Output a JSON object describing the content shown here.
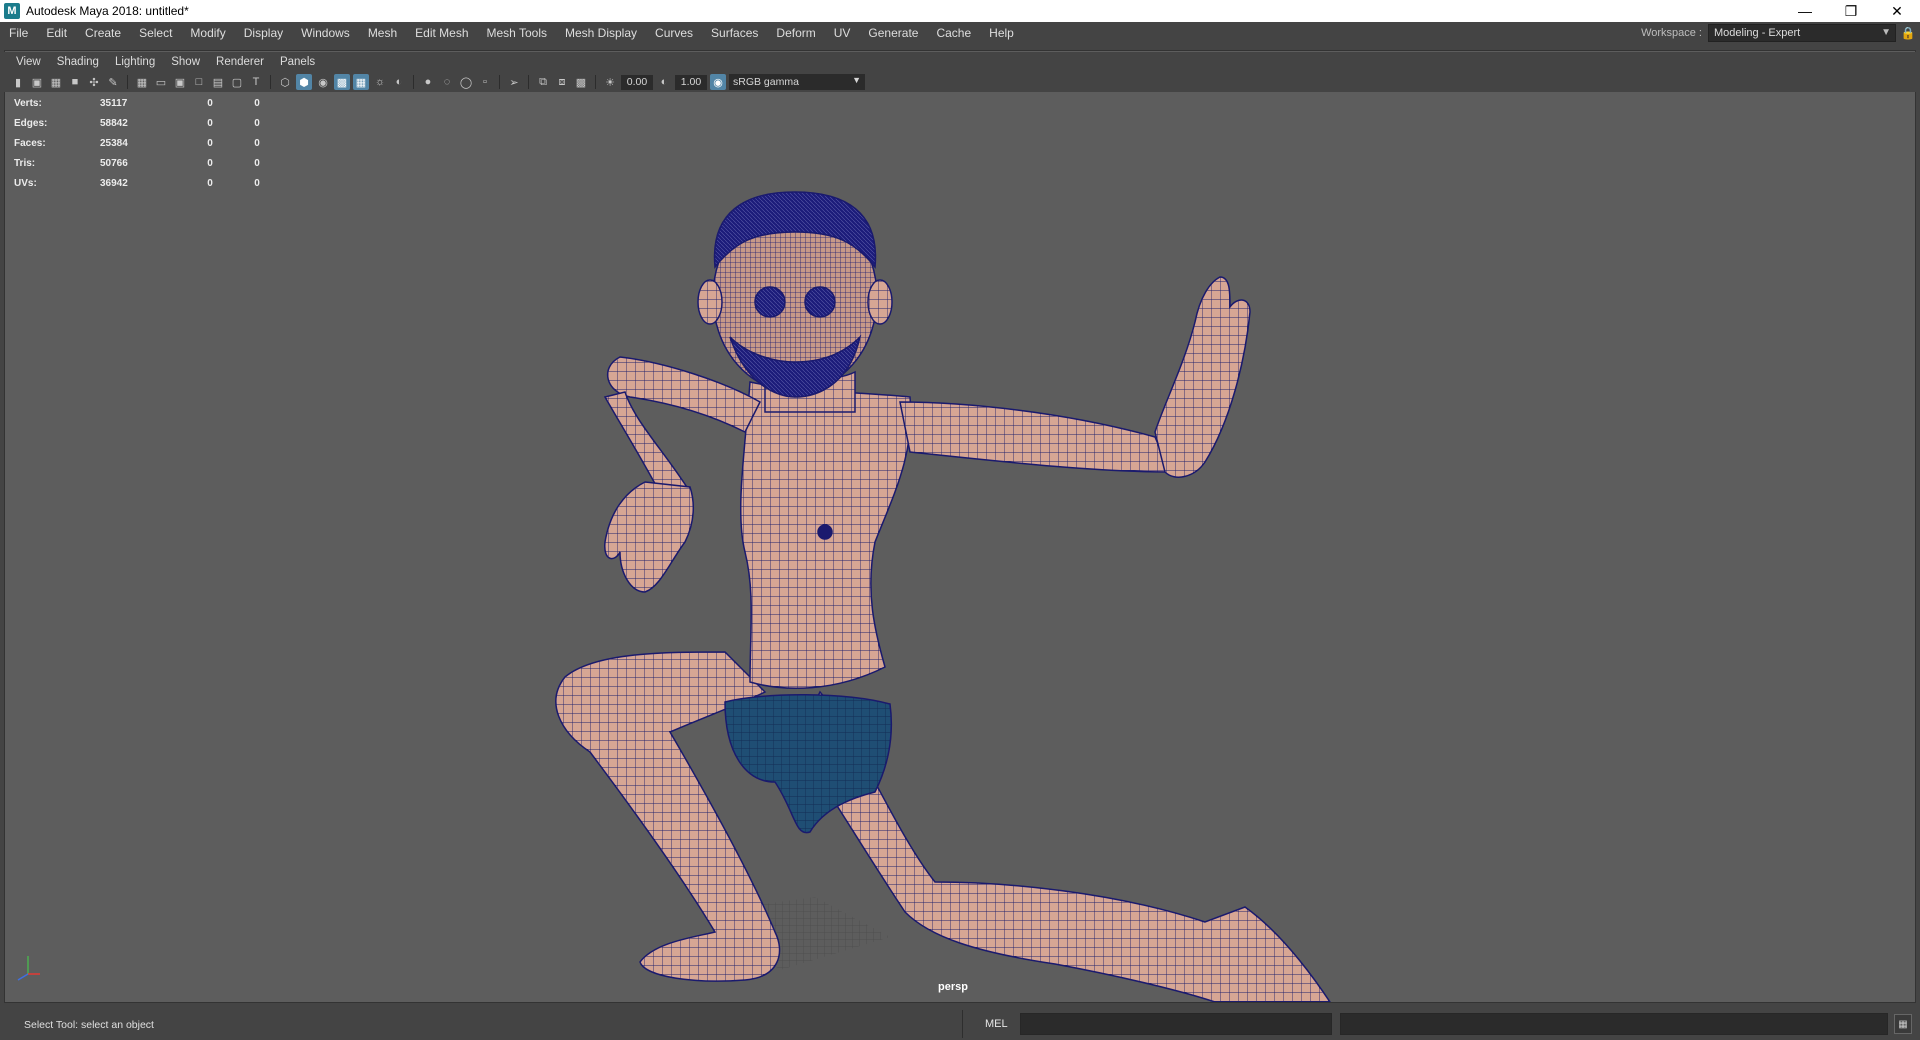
{
  "window": {
    "app_icon": "M",
    "title": "Autodesk Maya 2018: untitled*",
    "controls": [
      "minimize-icon",
      "restore-icon",
      "close-icon"
    ]
  },
  "menubar": {
    "items": [
      "File",
      "Edit",
      "Create",
      "Select",
      "Modify",
      "Display",
      "Windows",
      "Mesh",
      "Edit Mesh",
      "Mesh Tools",
      "Mesh Display",
      "Curves",
      "Surfaces",
      "Deform",
      "UV",
      "Generate",
      "Cache",
      "Help"
    ]
  },
  "workspace": {
    "label": "Workspace :",
    "value": "Modeling - Expert"
  },
  "panel_menu": {
    "items": [
      "View",
      "Shading",
      "Lighting",
      "Show",
      "Renderer",
      "Panels"
    ]
  },
  "toolbar": {
    "exposure": "0.00",
    "gamma": "1.00",
    "color_space": "sRGB gamma"
  },
  "hud": {
    "rows": [
      {
        "label": "Verts:",
        "v1": "35117",
        "v2": "0",
        "v3": "0"
      },
      {
        "label": "Edges:",
        "v1": "58842",
        "v2": "0",
        "v3": "0"
      },
      {
        "label": "Faces:",
        "v1": "25384",
        "v2": "0",
        "v3": "0"
      },
      {
        "label": "Tris:",
        "v1": "50766",
        "v2": "0",
        "v3": "0"
      },
      {
        "label": "UVs:",
        "v1": "36942",
        "v2": "0",
        "v3": "0"
      }
    ]
  },
  "viewport": {
    "camera": "persp",
    "colors": {
      "background": "#5d5d5d",
      "skin": "#d9a997",
      "wire": "#1a1a6e",
      "shorts": "#1e4d75"
    }
  },
  "statusbar": {
    "message": "Select Tool: select an object",
    "mel_label": "MEL"
  }
}
